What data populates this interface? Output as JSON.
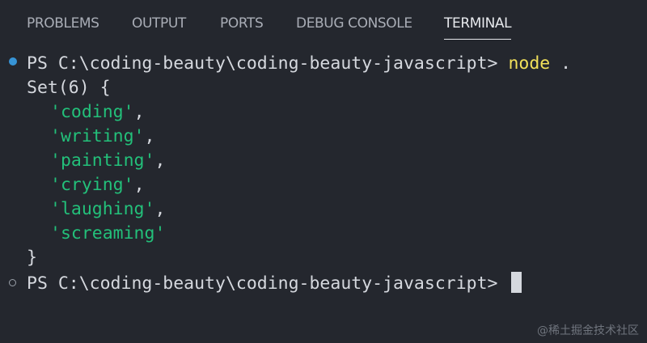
{
  "panel": {
    "tabs": [
      {
        "label": "PROBLEMS"
      },
      {
        "label": "OUTPUT"
      },
      {
        "label": "PORTS"
      },
      {
        "label": "DEBUG CONSOLE"
      },
      {
        "label": "TERMINAL"
      }
    ],
    "active_tab": "TERMINAL"
  },
  "terminal": {
    "prompt": "PS C:\\coding-beauty\\coding-beauty-javascript>",
    "command": "node",
    "command_arg": ".",
    "output_header": "Set(6) {",
    "set_items": [
      "'coding'",
      "'writing'",
      "'painting'",
      "'crying'",
      "'laughing'",
      "'screaming'"
    ],
    "item_separator": ",",
    "output_footer": "}",
    "prompt2": "PS C:\\coding-beauty\\coding-beauty-javascript>"
  },
  "watermark": "@稀土掘金技术社区",
  "colors": {
    "background": "#24272e",
    "string": "#23c07a",
    "command": "#f1e05a",
    "status_dot_success": "#3794d6"
  }
}
